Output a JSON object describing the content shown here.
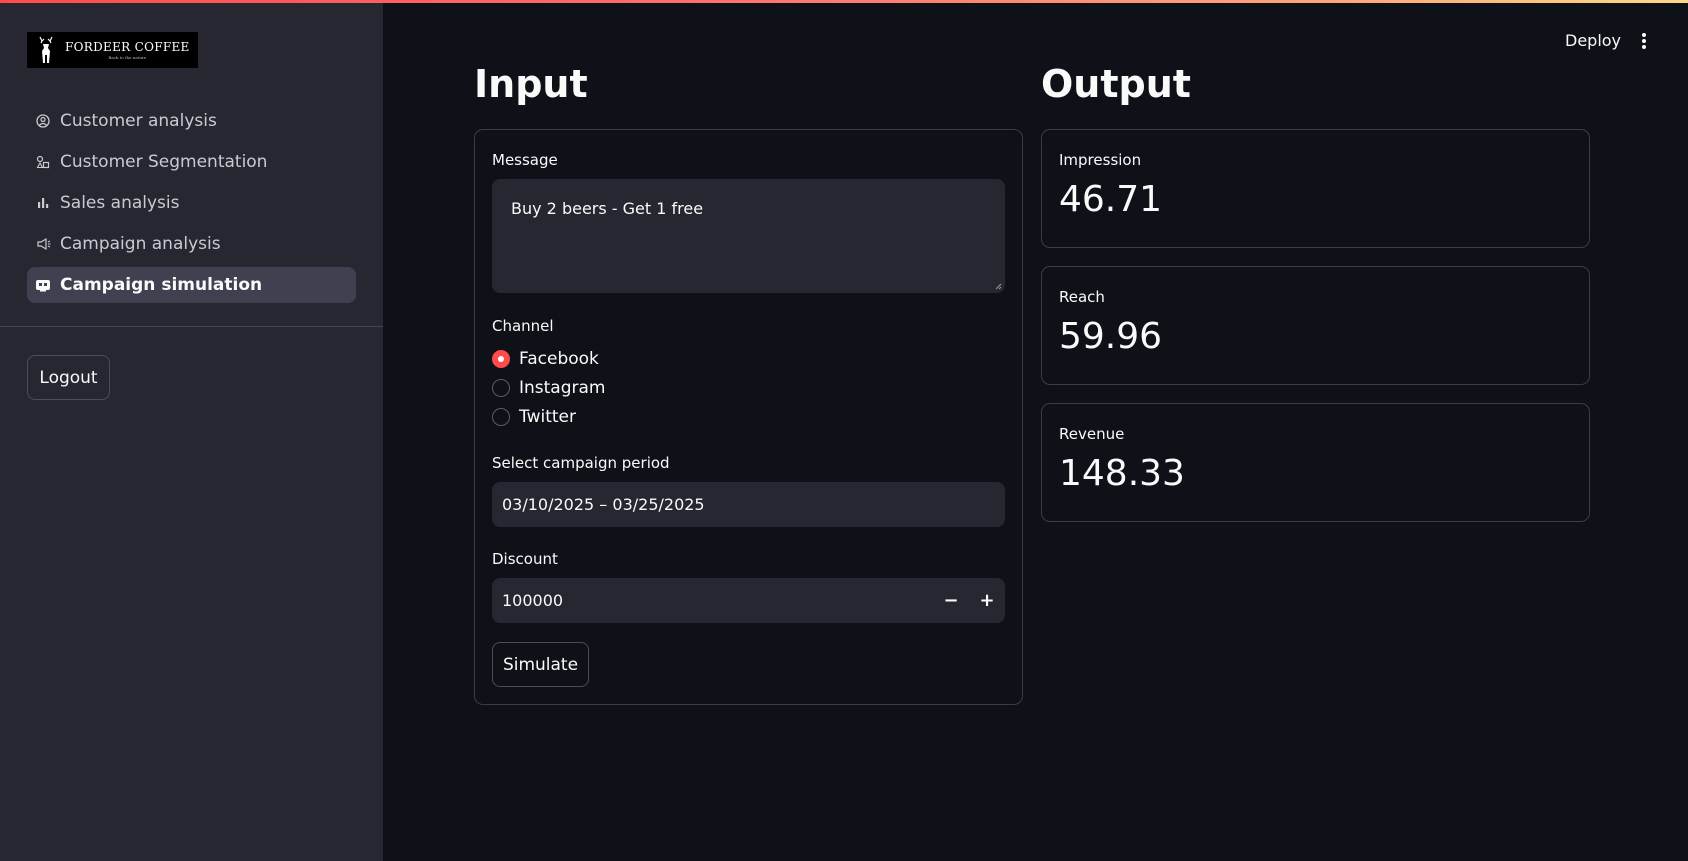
{
  "sidebar": {
    "logo": {
      "name": "FORDEER COFFEE",
      "tagline": "Back to the nature"
    },
    "nav": [
      {
        "label": "Customer analysis",
        "icon": "person-circle-icon",
        "active": false
      },
      {
        "label": "Customer Segmentation",
        "icon": "segments-icon",
        "active": false
      },
      {
        "label": "Sales analysis",
        "icon": "bar-chart-icon",
        "active": false
      },
      {
        "label": "Campaign analysis",
        "icon": "megaphone-icon",
        "active": false
      },
      {
        "label": "Campaign simulation",
        "icon": "simulation-icon",
        "active": true
      }
    ],
    "logout_label": "Logout"
  },
  "header": {
    "deploy_label": "Deploy",
    "menu_icon": "kebab-menu-icon"
  },
  "input": {
    "title": "Input",
    "message_label": "Message",
    "message_value": "Buy 2 beers - Get 1 free",
    "channel_label": "Channel",
    "channels": [
      {
        "label": "Facebook",
        "checked": true
      },
      {
        "label": "Instagram",
        "checked": false
      },
      {
        "label": "Twitter",
        "checked": false
      }
    ],
    "period_label": "Select campaign period",
    "period_value": "03/10/2025 – 03/25/2025",
    "discount_label": "Discount",
    "discount_value": "100000",
    "minus_label": "−",
    "plus_label": "+",
    "simulate_label": "Simulate"
  },
  "output": {
    "title": "Output",
    "metrics": [
      {
        "label": "Impression",
        "value": "46.71"
      },
      {
        "label": "Reach",
        "value": "59.96"
      },
      {
        "label": "Revenue",
        "value": "148.33"
      }
    ]
  },
  "colors": {
    "accent": "#ff4b4b",
    "background": "#0e1117",
    "sidebar": "#262730",
    "active_nav": "#3f4150"
  }
}
